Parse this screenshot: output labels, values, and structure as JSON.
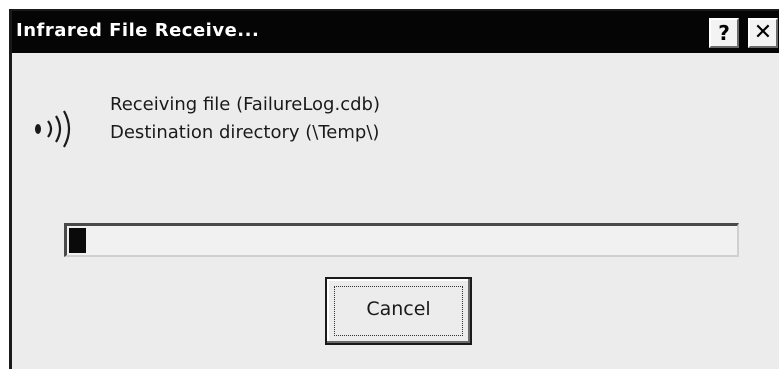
{
  "window": {
    "title": "Infrared File Receive...",
    "help_label": "?",
    "close_label": "✕"
  },
  "message": {
    "line1": "Receiving file (FailureLog.cdb)",
    "line2": "Destination directory (\\Temp\\)"
  },
  "progress": {
    "fraction": 0.025
  },
  "buttons": {
    "cancel_label": "Cancel"
  },
  "icons": {
    "transfer": "infrared-signal-icon"
  },
  "colors": {
    "titlebar_bg": "#050505",
    "title_text": "#ffffff",
    "window_bg": "#ececec",
    "progress_fill": "#0a0a0a"
  }
}
